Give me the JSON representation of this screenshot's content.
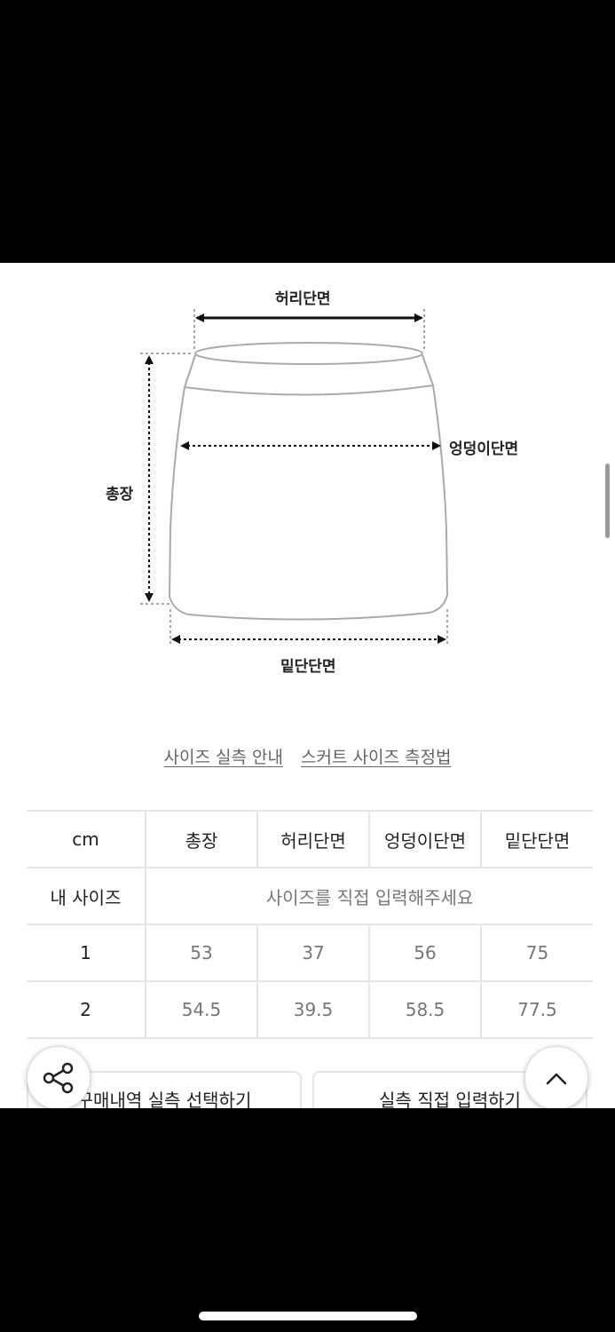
{
  "diagram": {
    "waist_label": "허리단면",
    "hip_label": "엉덩이단면",
    "length_label": "총장",
    "hem_label": "밑단단면"
  },
  "links": {
    "size_guide": "사이즈 실측 안내",
    "measure_guide": "스커트 사이즈 측정법"
  },
  "table": {
    "headers": [
      "cm",
      "총장",
      "허리단면",
      "엉덩이단면",
      "밑단단면"
    ],
    "my_size_label": "내 사이즈",
    "my_size_placeholder": "사이즈를 직접 입력해주세요",
    "rows": [
      {
        "size": "1",
        "values": [
          "53",
          "37",
          "56",
          "75"
        ]
      },
      {
        "size": "2",
        "values": [
          "54.5",
          "39.5",
          "58.5",
          "77.5"
        ]
      }
    ]
  },
  "buttons": {
    "select_from_purchase": "구매내역 실측 선택하기",
    "enter_directly": "실측 직접 입력하기"
  },
  "icons": {
    "share": "share-icon",
    "scroll_top": "chevron-up-icon"
  }
}
